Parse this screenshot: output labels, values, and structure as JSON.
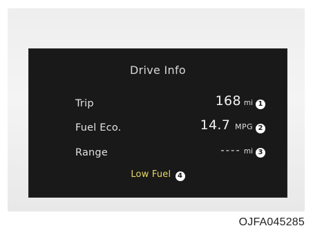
{
  "display": {
    "title": "Drive Info",
    "rows": [
      {
        "label": "Trip",
        "value": "168",
        "unit": "mi",
        "callout": "1"
      },
      {
        "label": "Fuel Eco.",
        "value": "14.7",
        "unit": "MPG",
        "callout": "2"
      },
      {
        "label": "Range",
        "value": "----",
        "unit": "mi",
        "callout": "3"
      }
    ],
    "warning": {
      "text": "Low Fuel",
      "callout": "4"
    }
  },
  "figure": {
    "code": "OJFA045285"
  },
  "colors": {
    "screen_background": "#191919",
    "bezel": "#efefef",
    "warning_text": "#e8d860",
    "text": "#e2e2e2"
  }
}
